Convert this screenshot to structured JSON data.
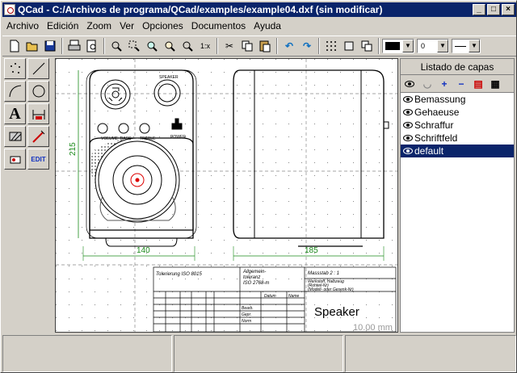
{
  "window": {
    "title": "QCad - C:/Archivos de programa/QCad/examples/example04.dxf (sin modificar)"
  },
  "menu": [
    "Archivo",
    "Edición",
    "Zoom",
    "Ver",
    "Opciones",
    "Documentos",
    "Ayuda"
  ],
  "toolbar": {
    "zoom_label": "1:x",
    "width_value": "0",
    "icons": [
      "new-file-icon",
      "open-folder-icon",
      "save-icon",
      "print-icon",
      "print-preview-icon",
      "zoom-auto-icon",
      "zoom-window-icon",
      "zoom-in-icon",
      "zoom-out-icon",
      "zoom-pan-icon",
      "zoom-1x-icon",
      "cut-icon",
      "copy-icon",
      "paste-icon",
      "undo-icon",
      "redo-icon",
      "grid-icon",
      "snap-icon",
      "layers-icon"
    ]
  },
  "layers": {
    "title": "Listado de capas",
    "items": [
      "Bemassung",
      "Gehaeuse",
      "Schraffur",
      "Schriftfeld",
      "default"
    ],
    "selected": "default"
  },
  "drawing": {
    "dim_front_width": "140",
    "dim_side_width": "185",
    "dim_height": "215",
    "label_volume": "VOLUME",
    "label_bass": "BASS",
    "label_treble": "TREBLE",
    "label_power": "POWER",
    "label_speaker": "SPEAKER",
    "tb_tolerancia": "Tolerierung ISO 8015",
    "tb_allgemein": "Allgemein-",
    "tb_toleranz": "toleranz",
    "tb_iso": "ISO 2768-m",
    "tb_masstab": "Massstab  2 : 1",
    "tb_werkstoff": "Werkstoff, Halbzeug",
    "tb_rohteil": "(Rohteil-Nr)",
    "tb_modell": "(Modell- oder Gesenk-Nr)",
    "tb_datum": "Datum",
    "tb_name": "Name",
    "tb_bearb": "Bearb.",
    "tb_gepr": "Gepr.",
    "tb_norm": "Norm",
    "tb_title": "Speaker",
    "tb_size": "10.00 mm"
  }
}
